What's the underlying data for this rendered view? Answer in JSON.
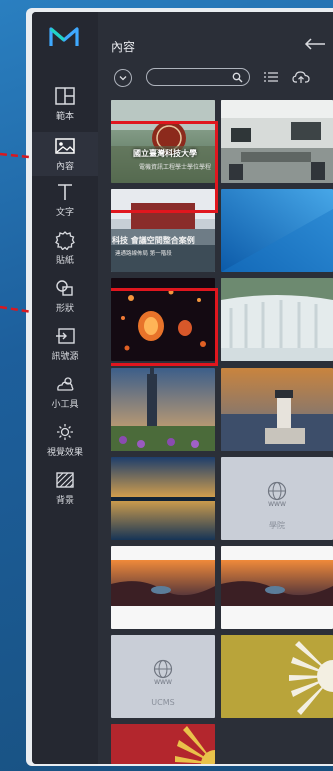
{
  "sidebar": {
    "items": [
      {
        "label": "範本",
        "icon": "template-icon"
      },
      {
        "label": "內容",
        "icon": "image-icon"
      },
      {
        "label": "文字",
        "icon": "text-icon"
      },
      {
        "label": "貼紙",
        "icon": "sticker-icon"
      },
      {
        "label": "形狀",
        "icon": "shape-icon"
      },
      {
        "label": "訊號源",
        "icon": "signal-source-icon"
      },
      {
        "label": "小工具",
        "icon": "widget-icon"
      },
      {
        "label": "視覺效果",
        "icon": "visual-effect-icon"
      },
      {
        "label": "背景",
        "icon": "background-icon"
      }
    ]
  },
  "content": {
    "title": "內容",
    "search": {
      "placeholder": "",
      "value": ""
    }
  },
  "tiles": {
    "t1": {
      "seal_text": "國立臺灣科技大學",
      "subtitle": "電機資訊工程學士學位學程"
    },
    "t3": {
      "line1": "科技  會議空間整合案例",
      "line2": "連通路線佈局  第一階段"
    },
    "t10_label": "學院",
    "t13_label": "UCMS"
  },
  "colors": {
    "highlight": "#e0161e",
    "sidebar_bg": "#252831",
    "content_bg": "#2b2f38"
  }
}
